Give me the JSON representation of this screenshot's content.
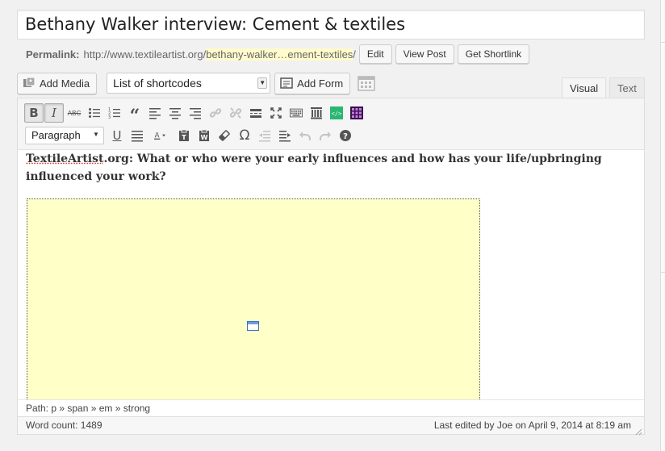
{
  "post": {
    "title": "Bethany Walker interview: Cement & textiles"
  },
  "permalink": {
    "label": "Permalink:",
    "base": "http://www.textileartist.org/",
    "slug": "bethany-walker…ement-textiles",
    "trail": "/",
    "edit_label": "Edit",
    "view_label": "View Post",
    "shortlink_label": "Get Shortlink"
  },
  "media_bar": {
    "add_media_label": "Add Media",
    "shortcodes_selected": "List of shortcodes",
    "add_form_label": "Add Form"
  },
  "editor_tabs": [
    {
      "label": "Visual",
      "active": true
    },
    {
      "label": "Text",
      "active": false
    }
  ],
  "toolbar": {
    "format_selected": "Paragraph",
    "row1_icons": [
      "bold-icon",
      "italic-icon",
      "strikethrough-icon",
      "bullet-list-icon",
      "numbered-list-icon",
      "blockquote-icon",
      "align-left-icon",
      "align-center-icon",
      "align-right-icon",
      "link-icon",
      "unlink-icon",
      "read-more-icon",
      "fullscreen-icon",
      "keyboard-toggle-icon",
      "columns-icon",
      "code-embed-icon",
      "table-grid-icon"
    ],
    "row2_icons": [
      "underline-icon",
      "justify-icon",
      "text-color-icon",
      "paste-text-icon",
      "paste-word-icon",
      "eraser-icon",
      "omega-icon",
      "outdent-icon",
      "indent-icon",
      "undo-icon",
      "redo-icon",
      "help-icon"
    ]
  },
  "content": {
    "site_name": "TextileArtist",
    "question": ".org: What or who were your early influences and how has your life/upbringing influenced your work?"
  },
  "path": {
    "text": "Path: p » span » em » strong"
  },
  "status": {
    "word_count": "Word count: 1489",
    "last_edited": "Last edited by Joe on April 9, 2014 at 8:19 am"
  },
  "colors": {
    "embed_bg": "#ffffc8",
    "slug_highlight": "#fffbcc",
    "code_icon": "#2bb673",
    "grid_icon": "#7b1fa2"
  }
}
